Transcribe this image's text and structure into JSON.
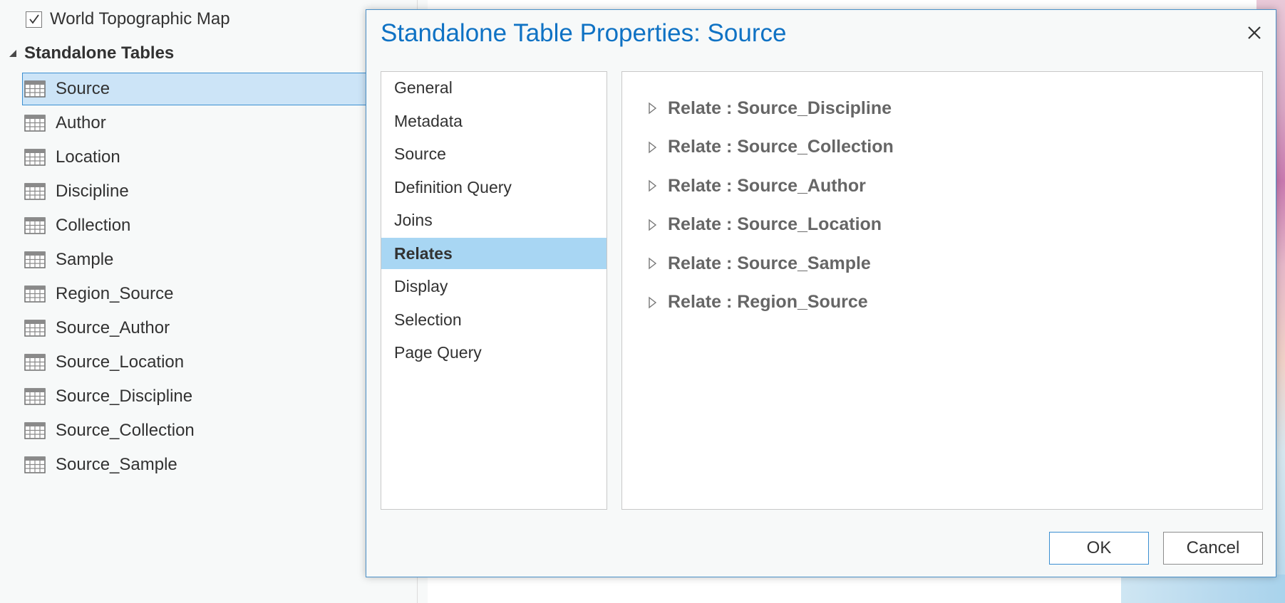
{
  "contents": {
    "basemap_label": "World Topographic Map",
    "basemap_checked": true,
    "group_label": "Standalone Tables",
    "tables": [
      {
        "label": "Source",
        "selected": true
      },
      {
        "label": "Author"
      },
      {
        "label": "Location"
      },
      {
        "label": "Discipline"
      },
      {
        "label": "Collection"
      },
      {
        "label": "Sample"
      },
      {
        "label": "Region_Source"
      },
      {
        "label": "Source_Author"
      },
      {
        "label": "Source_Location"
      },
      {
        "label": "Source_Discipline"
      },
      {
        "label": "Source_Collection"
      },
      {
        "label": "Source_Sample"
      }
    ]
  },
  "dialog": {
    "title": "Standalone Table Properties: Source",
    "nav_items": [
      {
        "label": "General"
      },
      {
        "label": "Metadata"
      },
      {
        "label": "Source"
      },
      {
        "label": "Definition Query"
      },
      {
        "label": "Joins"
      },
      {
        "label": "Relates",
        "active": true
      },
      {
        "label": "Display"
      },
      {
        "label": "Selection"
      },
      {
        "label": "Page Query"
      }
    ],
    "relates": [
      "Relate : Source_Discipline",
      "Relate : Source_Collection",
      "Relate : Source_Author",
      "Relate : Source_Location",
      "Relate : Source_Sample",
      "Relate : Region_Source"
    ],
    "ok_label": "OK",
    "cancel_label": "Cancel"
  },
  "colors": {
    "title": "#0f72c4",
    "selection": "#cce4f7",
    "nav_active": "#a8d6f3"
  },
  "icons": {
    "close": "close-icon",
    "table": "table-icon",
    "checkbox": "checkmark-icon",
    "expander": "collapse-triangle-icon",
    "relate_expander": "expand-triangle-icon"
  }
}
